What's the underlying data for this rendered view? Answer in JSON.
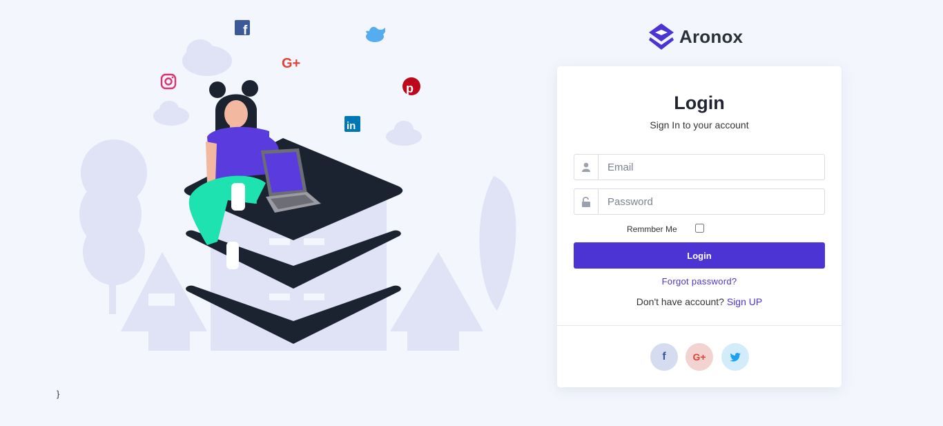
{
  "brand": {
    "name": "Aronox"
  },
  "login": {
    "title": "Login",
    "subtitle": "Sign In to your account",
    "email_placeholder": "Email",
    "password_placeholder": "Password",
    "remember_label": "Remmber Me",
    "remember_checked": false,
    "submit_label": "Login",
    "forgot_link": "Forgot password?",
    "no_account_text": "Don't have account?",
    "signup_link": "Sign UP"
  },
  "social_buttons": [
    {
      "icon": "facebook-icon",
      "label": "f"
    },
    {
      "icon": "google-plus-icon",
      "label": "G+"
    },
    {
      "icon": "twitter-icon"
    }
  ],
  "footer": {
    "stray_text": "}"
  },
  "colors": {
    "accent": "#4b33d4",
    "background": "#f3f6fd",
    "illustration_dark": "#1b2330",
    "illustration_light": "#e0e2f5",
    "facebook": "#3b5998",
    "google_plus": "#db4437",
    "twitter": "#1da1f2",
    "pinterest": "#bd081c",
    "linkedin": "#0077b5",
    "instagram": "#e1306c"
  }
}
